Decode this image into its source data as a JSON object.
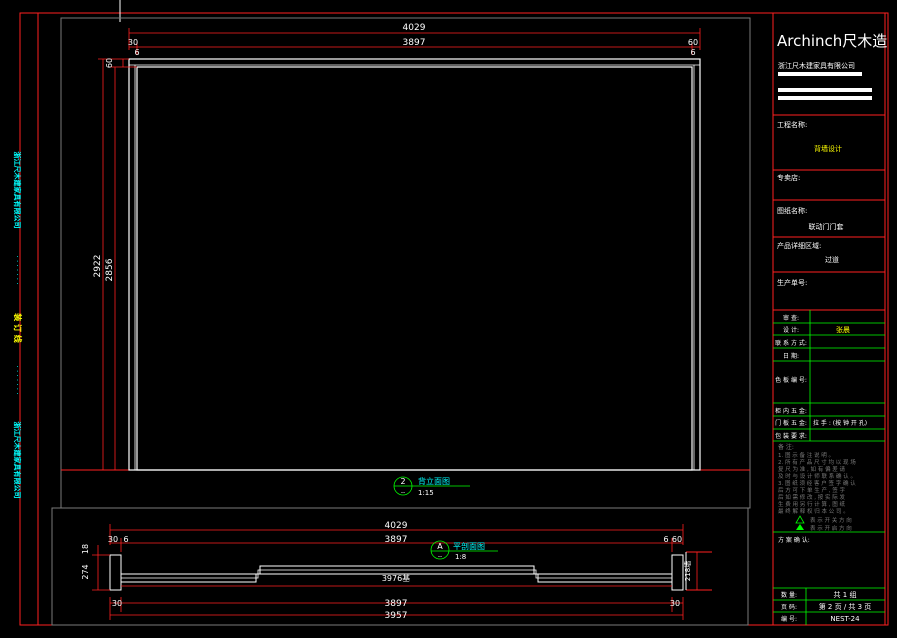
{
  "colors": {
    "red": "#ff2020",
    "white": "#ffffff",
    "cyan": "#00ffff",
    "yellow": "#ffff00",
    "green": "#00ff00",
    "gray": "#7a7a7a"
  },
  "elevation": {
    "dim_overall_width": "4029",
    "dim_inner_width": "3897",
    "dim_left_offset": "30",
    "dim_left_gap": "6",
    "dim_right_offset": "60",
    "dim_right_gap": "6",
    "dim_top": "60",
    "dim_height_total": "2922",
    "dim_height_inner": "2856",
    "label_number": "2",
    "label_sub": "--",
    "label_title": "背立面图",
    "label_scale": "1:15"
  },
  "plan": {
    "dim_overall_width": "4029",
    "dim_inner_width": "3897",
    "dim_left": "30",
    "dim_left_gap": "6",
    "dim_right_gap": "6",
    "dim_right": "60",
    "dim_depth": "274",
    "dim_depth_small": "18",
    "dim_inner_span": "3976",
    "dim_inner_span_suffix": "基",
    "dim_right_depth": "218",
    "dim_right_depth_suffix": "墙",
    "dim_bottom_left": "30",
    "dim_bottom_right": "30",
    "dim_bottom_inner": "3897",
    "dim_bottom_overall": "3957",
    "label_letter": "A",
    "label_sub": "--",
    "label_title": "平剖面图",
    "label_scale": "1:8"
  },
  "left_margin": {
    "company_top": "浙江尺木建家具有限公司",
    "dots_top": "· · · · · · ·",
    "binding_line": "装 订 线",
    "dots_bottom": "· · · · · · ·",
    "company_bottom": "浙江尺木建家具有限公司"
  },
  "title_block": {
    "logo": "Archinch尺木造",
    "company": "浙江尺木建家具有限公司",
    "project_label": "工程名称:",
    "project_value": "背墙设计",
    "store_label": "专卖店:",
    "drawing_label": "图纸名称:",
    "drawing_value": "联动门门套",
    "product_label": "产品详细区域:",
    "product_value": "过道",
    "order_label": "生产单号:",
    "review_label": "审 查:",
    "design_label": "设 计:",
    "design_value": "张晨",
    "contact_label": "联 系 方 式:",
    "date_label": "日 期:",
    "color_label": "色 板 编 号:",
    "cabinet_label": "柜 内 五 金:",
    "door_label": "门 板 五 金:",
    "door_value": "拉 手 : (按 钟 开 孔)",
    "surface_label": "包 装 要 求:",
    "notes_title": "备 注:",
    "notes": [
      "1. 图 示 备 注 说 明 。",
      "2. 所 有 产 品 尺 寸 均 以 现 场",
      "   复 尺 为 准 , 如 有 偏 差 请",
      "   及 时 与 设 计 师 联 系 确 认 。",
      "3. 图 纸 须 经 客 户 签 字 确 认",
      "   后 方 可 下 单 生 产 , 签 字",
      "   后 如 需 修 改 , 按 实 际 发",
      "   生 费 用 另 行 计 算 , 图 纸",
      "   最 终 解 释 权 归 本 公 司 。"
    ],
    "legend_1": "表 示 开 关 方 向",
    "legend_2": "表 示 开 启 方 向",
    "confirm_label": "方 案 确 认:",
    "qty_label": "数 量:",
    "qty_value": "共 1 组",
    "page_label": "页 码:",
    "page_value": "第 2 页 / 共 3 页",
    "number_label": "编 号:",
    "number_value": "NEST-24"
  }
}
